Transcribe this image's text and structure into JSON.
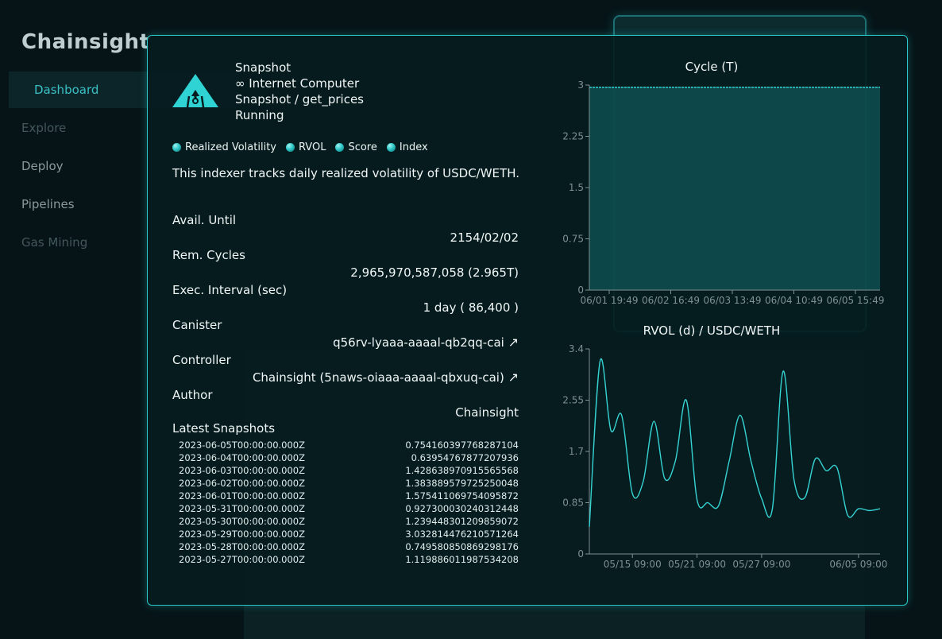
{
  "app": {
    "brand": "Chainsight",
    "nav": [
      {
        "label": "Dashboard",
        "state": "active"
      },
      {
        "label": "Explore",
        "state": "dim"
      },
      {
        "label": "Deploy",
        "state": "normal"
      },
      {
        "label": "Pipelines",
        "state": "normal"
      },
      {
        "label": "Gas Mining",
        "state": "dim"
      }
    ]
  },
  "modal": {
    "header": {
      "type": "Snapshot",
      "network": "∞ Internet Computer",
      "path": "Snapshot / get_prices",
      "status": "Running"
    },
    "tags": [
      "Realized Volatility",
      "RVOL",
      "Score",
      "Index"
    ],
    "description": "This indexer tracks daily realized volatility of USDC/WETH.",
    "info": [
      {
        "label": "Avail. Until",
        "value": "2154/02/02",
        "link": false
      },
      {
        "label": "Rem. Cycles",
        "value": "2,965,970,587,058 (2.965T)",
        "link": false
      },
      {
        "label": "Exec. Interval (sec)",
        "value": "1 day ( 86,400 )",
        "link": false
      },
      {
        "label": "Canister",
        "value": "q56rv-lyaaa-aaaal-qb2qq-cai",
        "link": true
      },
      {
        "label": "Controller",
        "value": "Chainsight (5naws-oiaaa-aaaal-qbxuq-cai)",
        "link": true
      },
      {
        "label": "Author",
        "value": "Chainsight",
        "link": false
      }
    ],
    "link_icon": "↗",
    "snapshots_title": "Latest Snapshots",
    "snapshots": [
      {
        "ts": "2023-06-05T00:00:00.000Z",
        "value": "0.754160397768287104"
      },
      {
        "ts": "2023-06-04T00:00:00.000Z",
        "value": "0.63954767877207936"
      },
      {
        "ts": "2023-06-03T00:00:00.000Z",
        "value": "1.428638970915565568"
      },
      {
        "ts": "2023-06-02T00:00:00.000Z",
        "value": "1.383889579725250048"
      },
      {
        "ts": "2023-06-01T00:00:00.000Z",
        "value": "1.575411069754095872"
      },
      {
        "ts": "2023-05-31T00:00:00.000Z",
        "value": "0.927300030240312448"
      },
      {
        "ts": "2023-05-30T00:00:00.000Z",
        "value": "1.239448301209859072"
      },
      {
        "ts": "2023-05-29T00:00:00.000Z",
        "value": "3.032814476210571264"
      },
      {
        "ts": "2023-05-28T00:00:00.000Z",
        "value": "0.749580850869298176"
      },
      {
        "ts": "2023-05-27T00:00:00.000Z",
        "value": "1.119886011987534208"
      }
    ]
  },
  "colors": {
    "accent": "#2bc7c7",
    "line": "#36d3d3",
    "fill": "#167c7c",
    "axis": "#7f9193"
  },
  "chart_data": [
    {
      "type": "area",
      "title": "Cycle (T)",
      "ylim": [
        0,
        3
      ],
      "y_ticks": [
        "0",
        "0.75",
        "1.5",
        "2.25",
        "3"
      ],
      "x_ticks": [
        "06/01 19:49",
        "06/02 16:49",
        "06/03 13:49",
        "06/04 10:49",
        "06/05 15:49"
      ],
      "series": [
        {
          "x": [
            "06/01 19:49",
            "06/05 15:49"
          ],
          "y": [
            2.966,
            2.966
          ]
        }
      ]
    },
    {
      "type": "line",
      "title": "RVOL (d) / USDC/WETH",
      "ylim": [
        0,
        3.4
      ],
      "y_ticks": [
        "0",
        "0.85",
        "1.7",
        "2.55",
        "3.4"
      ],
      "xlim": [
        "05/11",
        "06/07"
      ],
      "x_ticks": [
        {
          "label": "05/15 09:00",
          "x": "05/15"
        },
        {
          "label": "05/21 09:00",
          "x": "05/21"
        },
        {
          "label": "05/27 09:00",
          "x": "05/27"
        },
        {
          "label": "06/05 09:00",
          "x": "06/05"
        }
      ],
      "series": [
        {
          "x": [
            "05/11",
            "05/12",
            "05/13",
            "05/14",
            "05/15",
            "05/16",
            "05/17",
            "05/18",
            "05/19",
            "05/20",
            "05/21",
            "05/22",
            "05/23",
            "05/24",
            "05/25",
            "05/26",
            "05/27",
            "05/28",
            "05/29",
            "05/30",
            "05/31",
            "06/01",
            "06/02",
            "06/03",
            "06/04",
            "06/05",
            "06/06",
            "06/07"
          ],
          "y": [
            0.45,
            3.2,
            2.05,
            2.3,
            1.0,
            1.2,
            2.2,
            1.25,
            1.55,
            2.55,
            0.9,
            0.85,
            0.8,
            1.55,
            2.3,
            1.55,
            0.92,
            0.75,
            3.03,
            1.24,
            0.93,
            1.58,
            1.38,
            1.43,
            0.64,
            0.75,
            0.72,
            0.75
          ]
        }
      ]
    }
  ]
}
